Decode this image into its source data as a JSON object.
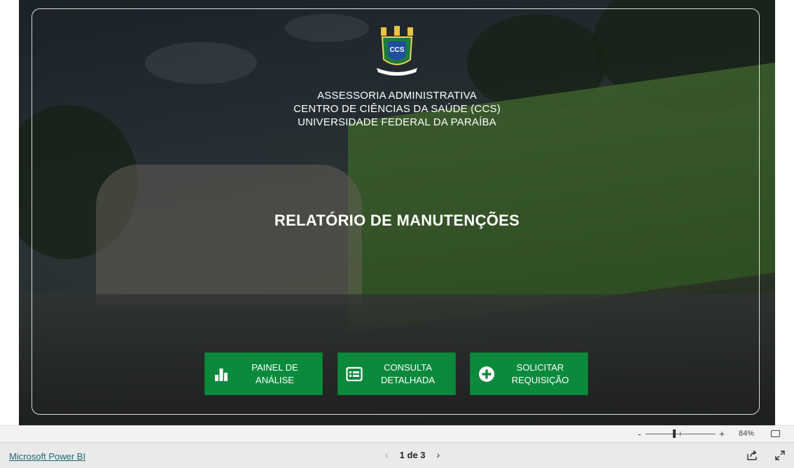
{
  "header": {
    "line1": "ASSESSORIA ADMINISTRATIVA",
    "line2": "CENTRO DE CIÊNCIAS DA SAÚDE (CCS)",
    "line3": "UNIVERSIDADE FEDERAL DA PARAÍBA"
  },
  "logo": {
    "text": "CCS",
    "icon": "ccs-crest-logo"
  },
  "report_title": "RELATÓRIO DE MANUTENÇÕES",
  "buttons": [
    {
      "line1": "PAINEL DE",
      "line2": "ANÁLISE",
      "icon": "bar-chart-icon"
    },
    {
      "line1": "CONSULTA",
      "line2": "DETALHADA",
      "icon": "table-icon"
    },
    {
      "line1": "SOLICITAR",
      "line2": "REQUISIÇÃO",
      "icon": "plus-circle-icon"
    }
  ],
  "zoom": {
    "minus": "-",
    "plus": "+",
    "percent": "84%",
    "value_percent": 84
  },
  "footer": {
    "brand_link": "Microsoft Power BI",
    "page_indicator": "1 de 3",
    "prev": "‹",
    "next": "›"
  },
  "colors": {
    "button_green": "#0b8a3c",
    "link_teal": "#1a6a70",
    "footer_bg": "#eaeaea"
  }
}
